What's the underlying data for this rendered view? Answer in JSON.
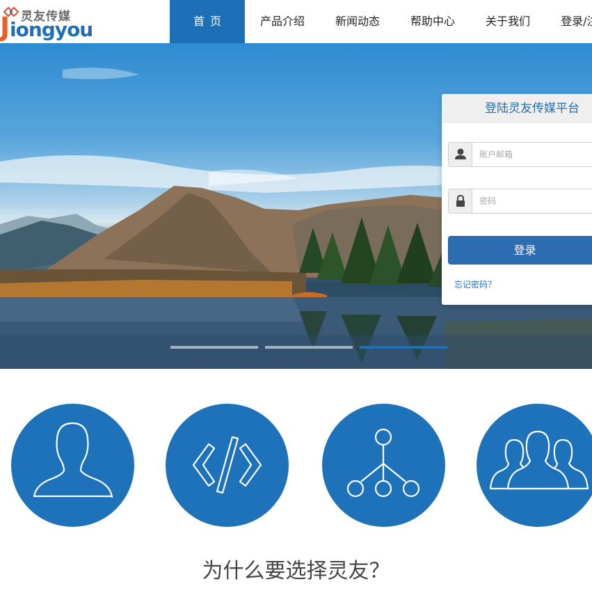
{
  "logo": {
    "cn": "灵友传媒",
    "initial": "J",
    "en": "iongyou"
  },
  "nav": {
    "items": [
      {
        "label": "首页",
        "active": true
      },
      {
        "label": "产品介绍",
        "active": false
      },
      {
        "label": "新闻动态",
        "active": false
      },
      {
        "label": "帮助中心",
        "active": false
      },
      {
        "label": "关于我们",
        "active": false
      },
      {
        "label": "登录/注册",
        "active": false
      }
    ]
  },
  "slider": {
    "slides": 3,
    "active_index": 2
  },
  "login": {
    "title": "登陆灵友传媒平台",
    "account_placeholder": "账户邮箱",
    "password_placeholder": "密码",
    "submit_label": "登录",
    "forgot_label": "忘记密码？",
    "account_icon": "user-icon",
    "password_icon": "lock-icon"
  },
  "features": [
    {
      "icon": "person-icon"
    },
    {
      "icon": "code-icon"
    },
    {
      "icon": "network-icon"
    },
    {
      "icon": "group-icon"
    }
  ],
  "section": {
    "why_title": "为什么要选择灵友？"
  },
  "colors": {
    "brand": "#1f6fb6",
    "feature_circle": "#1d72ba",
    "logo_accent": "#e5602a"
  }
}
